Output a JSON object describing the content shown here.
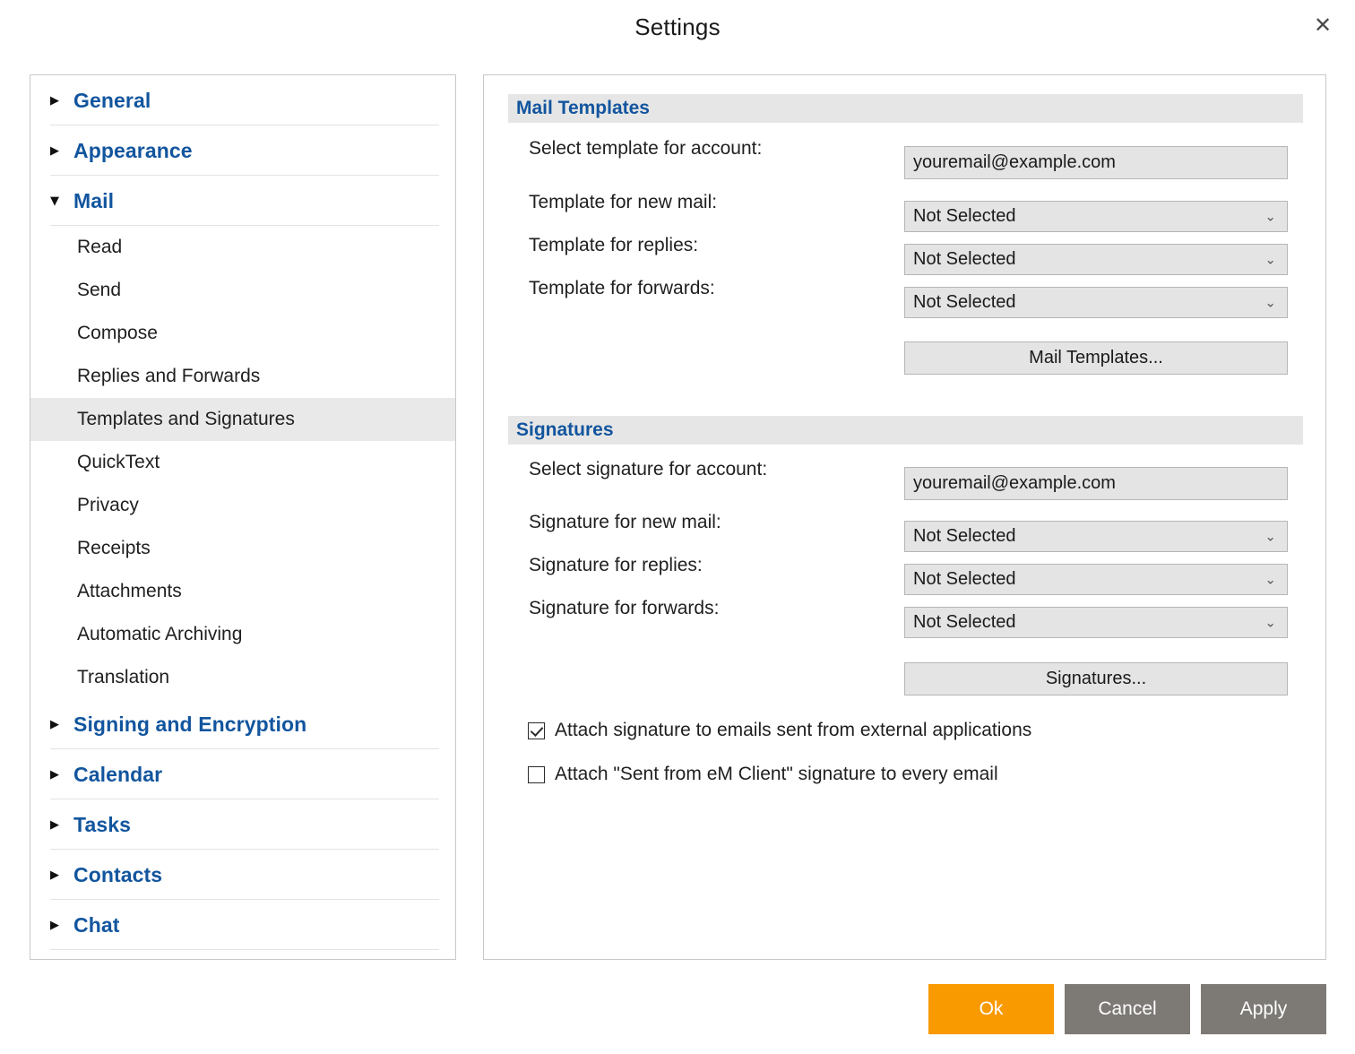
{
  "window": {
    "title": "Settings",
    "close_icon": "close-icon"
  },
  "colors": {
    "accent_blue": "#12559e",
    "ok_orange": "#f99a00",
    "button_gray": "#7d7a76",
    "panel_border": "#c8c8c8",
    "field_fill": "#e4e4e4",
    "section_header_fill": "#e6e6e6",
    "selected_row": "#e9e9e9"
  },
  "sidebar": {
    "groups": [
      {
        "label": "General",
        "expanded": false,
        "arrow": "chevron-right-icon",
        "items": []
      },
      {
        "label": "Appearance",
        "expanded": false,
        "arrow": "chevron-right-icon",
        "items": []
      },
      {
        "label": "Mail",
        "expanded": true,
        "arrow": "chevron-down-icon",
        "items": [
          {
            "label": "Read",
            "selected": false
          },
          {
            "label": "Send",
            "selected": false
          },
          {
            "label": "Compose",
            "selected": false
          },
          {
            "label": "Replies and Forwards",
            "selected": false
          },
          {
            "label": "Templates and Signatures",
            "selected": true
          },
          {
            "label": "QuickText",
            "selected": false
          },
          {
            "label": "Privacy",
            "selected": false
          },
          {
            "label": "Receipts",
            "selected": false
          },
          {
            "label": "Attachments",
            "selected": false
          },
          {
            "label": "Automatic Archiving",
            "selected": false
          },
          {
            "label": "Translation",
            "selected": false
          }
        ]
      },
      {
        "label": "Signing and Encryption",
        "expanded": false,
        "arrow": "chevron-right-icon",
        "items": []
      },
      {
        "label": "Calendar",
        "expanded": false,
        "arrow": "chevron-right-icon",
        "items": []
      },
      {
        "label": "Tasks",
        "expanded": false,
        "arrow": "chevron-right-icon",
        "items": []
      },
      {
        "label": "Contacts",
        "expanded": false,
        "arrow": "chevron-right-icon",
        "items": []
      },
      {
        "label": "Chat",
        "expanded": false,
        "arrow": "chevron-right-icon",
        "items": []
      }
    ]
  },
  "content": {
    "mail_templates": {
      "header": "Mail Templates",
      "account_label": "Select template for account:",
      "account_value": "youremail@example.com",
      "new_mail_label": "Template for new mail:",
      "new_mail_value": "Not Selected",
      "replies_label": "Template for replies:",
      "replies_value": "Not Selected",
      "forwards_label": "Template for forwards:",
      "forwards_value": "Not Selected",
      "button_label": "Mail Templates..."
    },
    "signatures": {
      "header": "Signatures",
      "account_label": "Select signature for account:",
      "account_value": "youremail@example.com",
      "new_mail_label": "Signature for new mail:",
      "new_mail_value": "Not Selected",
      "replies_label": "Signature for replies:",
      "replies_value": "Not Selected",
      "forwards_label": "Signature for forwards:",
      "forwards_value": "Not Selected",
      "button_label": "Signatures..."
    },
    "checkboxes": [
      {
        "label": "Attach signature to emails sent from external applications",
        "checked": true
      },
      {
        "label": "Attach \"Sent from eM Client\" signature to every email",
        "checked": false
      }
    ]
  },
  "footer": {
    "ok_label": "Ok",
    "cancel_label": "Cancel",
    "apply_label": "Apply"
  }
}
